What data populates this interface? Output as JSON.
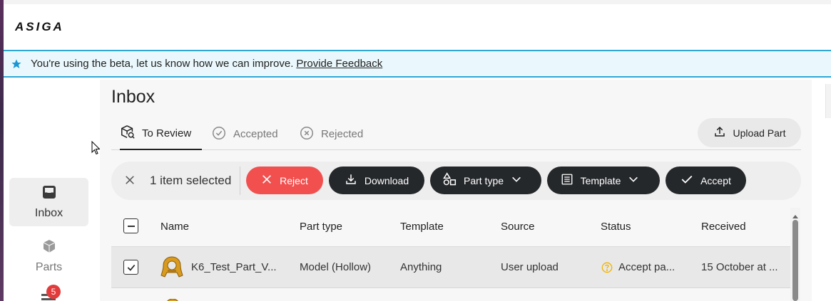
{
  "app": {
    "brand": "ASIGA"
  },
  "banner": {
    "message": "You're using the beta, let us know how we can improve.",
    "link": "Provide Feedback",
    "icon": "star-icon"
  },
  "sidebar": {
    "items": [
      {
        "label": "Inbox",
        "icon": "inbox-icon",
        "active": true
      },
      {
        "label": "Parts",
        "icon": "cube-icon",
        "active": false
      }
    ],
    "badge_count": "5"
  },
  "page": {
    "title": "Inbox",
    "tabs": [
      {
        "label": "To Review",
        "icon": "review-icon",
        "active": true
      },
      {
        "label": "Accepted",
        "icon": "check-circle-icon",
        "active": false
      },
      {
        "label": "Rejected",
        "icon": "x-circle-icon",
        "active": false
      }
    ],
    "upload_label": "Upload Part"
  },
  "actions": {
    "selected_text": "1 item selected",
    "reject": "Reject",
    "download": "Download",
    "part_type": "Part type",
    "template": "Template",
    "accept": "Accept"
  },
  "table": {
    "columns": [
      "Name",
      "Part type",
      "Template",
      "Source",
      "Status",
      "Received"
    ],
    "rows": [
      {
        "name": "K6_Test_Part_V...",
        "part_type": "Model (Hollow)",
        "template": "Anything",
        "source": "User upload",
        "status": "Accept pa...",
        "received": "15 October at ...",
        "checked": true
      }
    ]
  },
  "colors": {
    "accent": "#2fa8d6",
    "banner_bg": "#eaf8fd",
    "reject": "#f1504f",
    "dark_button": "#25282b",
    "badge": "#e23b3b",
    "part_gold": "#d99a1e",
    "status_warning": "#f0b400"
  }
}
